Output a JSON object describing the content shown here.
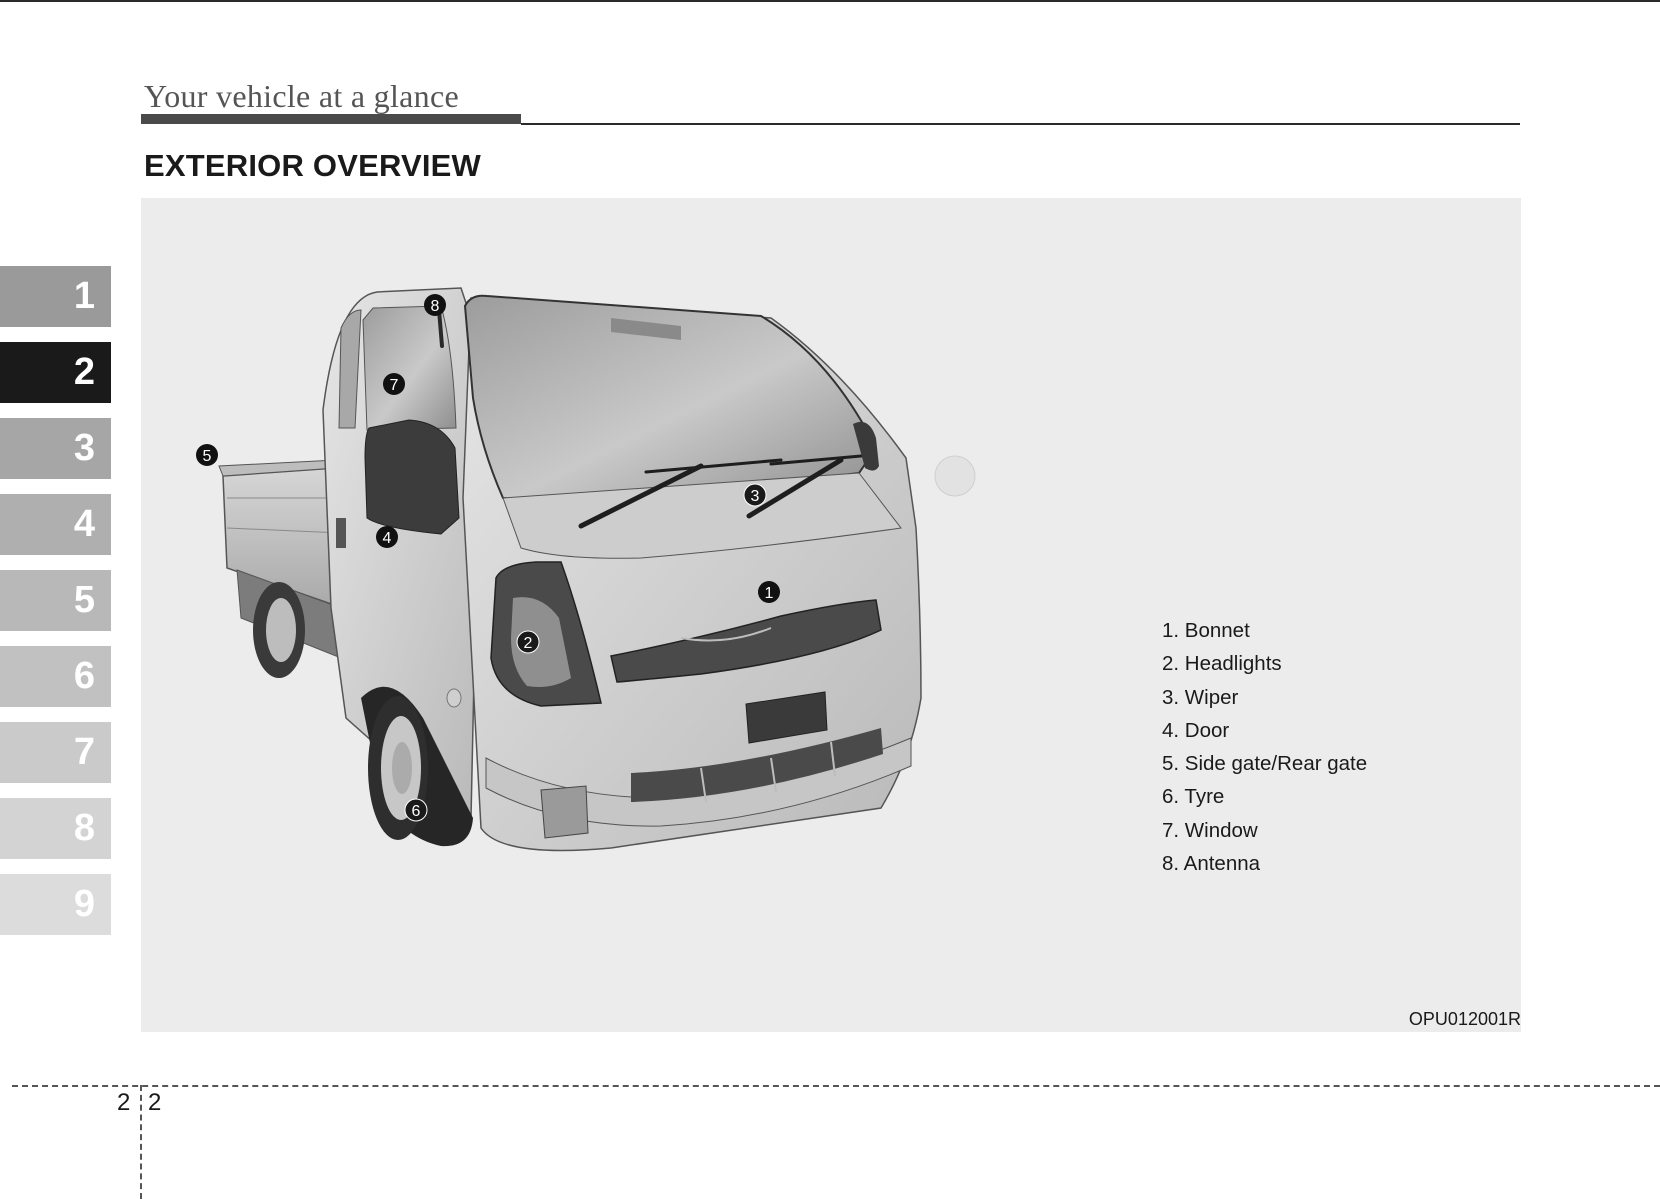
{
  "header": {
    "section_title": "Your vehicle at a glance",
    "page_heading": "EXTERIOR OVERVIEW"
  },
  "chapter_tabs": [
    {
      "label": "1",
      "color": "#9a9a9a",
      "active": false
    },
    {
      "label": "2",
      "color": "#1a1a1a",
      "active": true
    },
    {
      "label": "3",
      "color": "#a6a6a6",
      "active": false
    },
    {
      "label": "4",
      "color": "#afafaf",
      "active": false
    },
    {
      "label": "5",
      "color": "#b8b8b8",
      "active": false
    },
    {
      "label": "6",
      "color": "#c1c1c1",
      "active": false
    },
    {
      "label": "7",
      "color": "#cacaca",
      "active": false
    },
    {
      "label": "8",
      "color": "#d3d3d3",
      "active": false
    },
    {
      "label": "9",
      "color": "#dcdcdc",
      "active": false
    }
  ],
  "figure": {
    "callouts": [
      "1",
      "2",
      "3",
      "4",
      "5",
      "6",
      "7",
      "8"
    ],
    "parts": [
      "1. Bonnet",
      "2. Headlights",
      "3. Wiper",
      "4. Door",
      "5. Side gate/Rear gate",
      "6. Tyre",
      "7. Window",
      "8. Antenna"
    ],
    "code": "OPU012001R"
  },
  "footer": {
    "chapter_number": "2",
    "page_number": "2"
  }
}
